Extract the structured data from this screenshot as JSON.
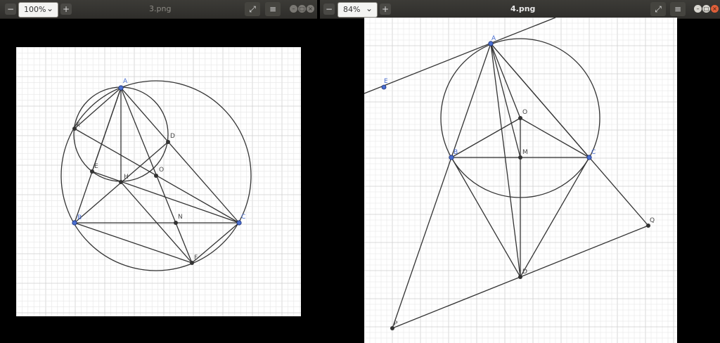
{
  "left_window": {
    "title": "3.png",
    "zoom": "100%",
    "points": [
      "A",
      "K",
      "D",
      "E",
      "H",
      "O",
      "B",
      "N",
      "C",
      "F"
    ]
  },
  "right_window": {
    "title": "4.png",
    "zoom": "84%",
    "points": [
      "A",
      "E",
      "O",
      "M",
      "B",
      "C",
      "Q",
      "D",
      "P"
    ]
  },
  "icons": {
    "zoom_out": "minus-icon",
    "zoom_in": "plus-icon",
    "fullscreen": "expand-icon",
    "menu": "hamburger-menu-icon",
    "minimize": "minimize-icon",
    "maximize": "maximize-icon",
    "close": "close-icon"
  }
}
